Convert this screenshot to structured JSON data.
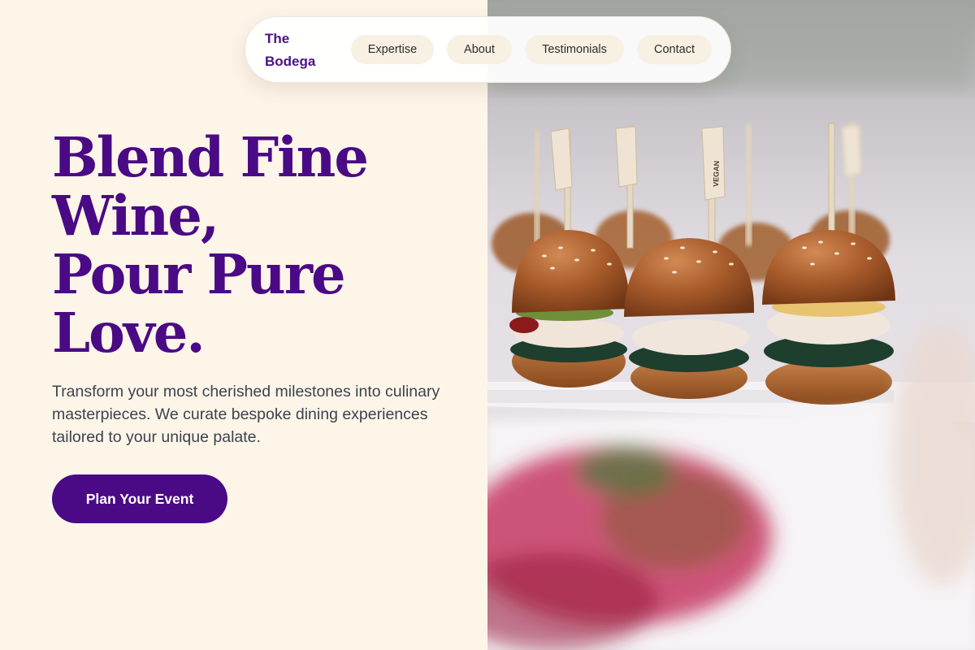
{
  "brand": {
    "line1": "The",
    "line2": "Bodega"
  },
  "nav": {
    "items": [
      {
        "label": "Expertise"
      },
      {
        "label": "About"
      },
      {
        "label": "Testimonials"
      },
      {
        "label": "Contact"
      }
    ]
  },
  "hero": {
    "title_lines": [
      "Blend Fine",
      "Wine,",
      "Pour Pure",
      "Love."
    ],
    "description": "Transform your most cherished milestones into culinary masterpieces. We curate bespoke dining experiences tailored to your unique palate.",
    "cta_label": "Plan Your Event"
  },
  "photo": {
    "pick_label": "VEGAN"
  },
  "colors": {
    "accent": "#4a0a85",
    "background": "#fdf5e8",
    "nav_pill": "#f8f0e2",
    "body_text": "#3d4250"
  }
}
